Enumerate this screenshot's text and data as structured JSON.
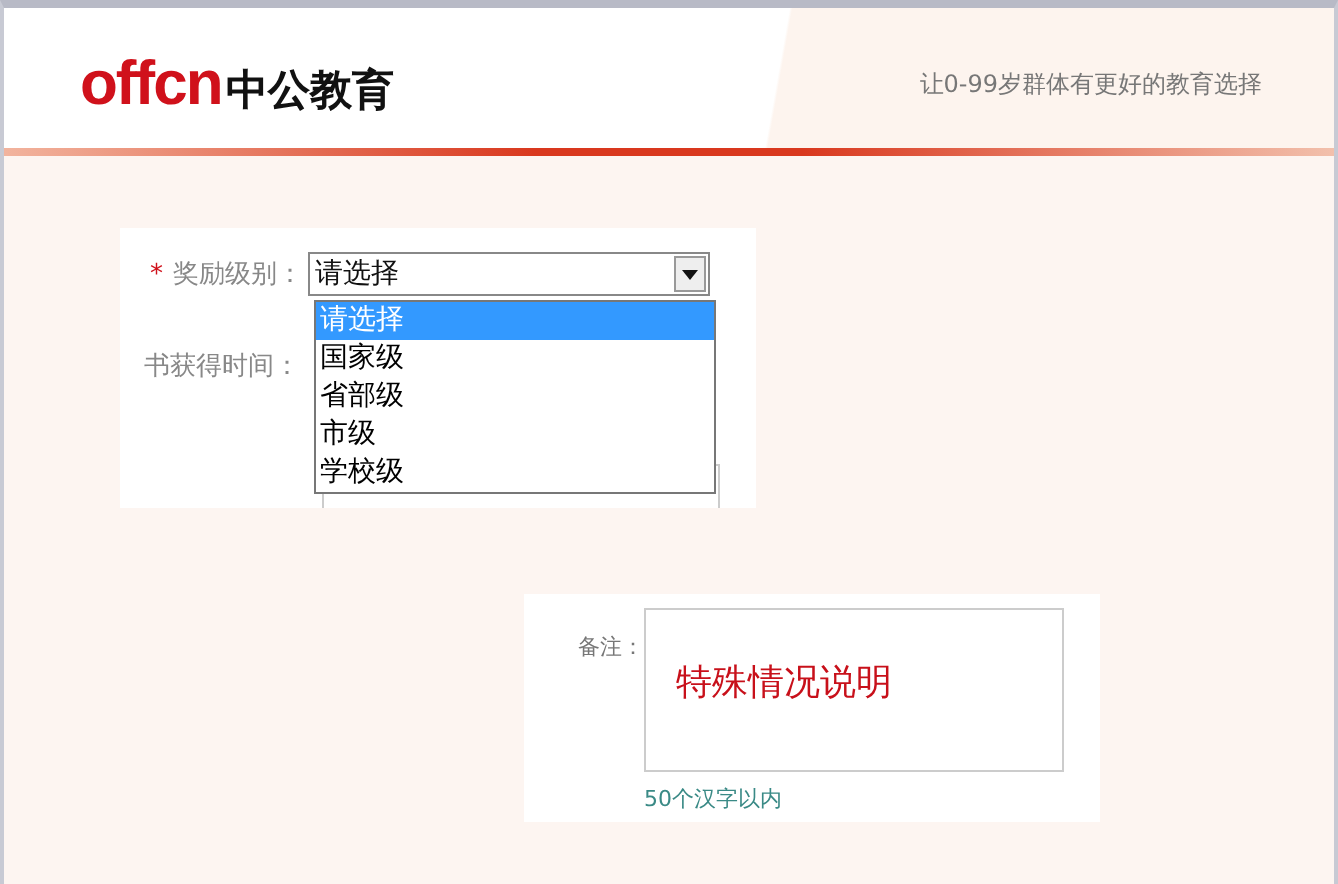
{
  "header": {
    "logo_latin": "offcn",
    "logo_cjk": "中公教育",
    "slogan": "让0-99岁群体有更好的教育选择"
  },
  "award_level": {
    "required_mark": "*",
    "label": "奖励级别：",
    "value": "请选择",
    "expanded": true,
    "options": [
      {
        "label": "请选择",
        "selected": true
      },
      {
        "label": "国家级",
        "selected": false
      },
      {
        "label": "省部级",
        "selected": false
      },
      {
        "label": "市级",
        "selected": false
      },
      {
        "label": "学校级",
        "selected": false
      }
    ]
  },
  "certificate_time": {
    "label": "书获得时间："
  },
  "remarks": {
    "label": "备注：",
    "value": "特殊情况说明",
    "hint": "50个汉字以内"
  }
}
